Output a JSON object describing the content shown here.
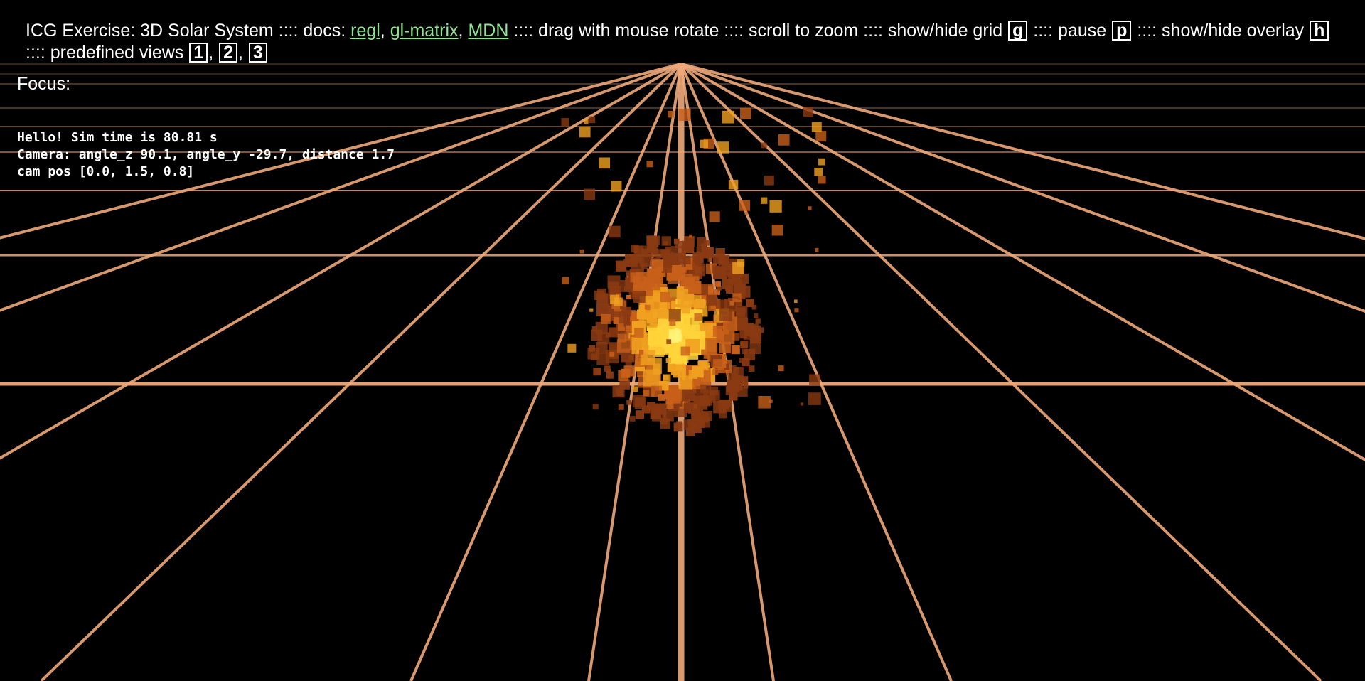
{
  "header": {
    "title": "ICG Exercise: 3D Solar System",
    "sep1": " :::: docs: ",
    "links": [
      {
        "label": "regl"
      },
      {
        "label": "gl-matrix"
      },
      {
        "label": "MDN"
      }
    ],
    "hint_rotate": " :::: drag with mouse rotate :::: scroll to zoom :::: show/hide grid ",
    "key_grid": "g",
    "hint_pause": " :::: pause ",
    "key_pause": "p",
    "hint_overlay": " :::: show/hide overlay ",
    "key_overlay": "h",
    "hint_views": " :::: predefined views ",
    "view_keys": [
      "1",
      "2",
      "3"
    ]
  },
  "focus": {
    "label": "Focus:"
  },
  "overlay": {
    "line1": "Hello! Sim time is 80.81 s",
    "line2": "Camera: angle_z 90.1, angle_y -29.7, distance 1.7",
    "line3": "cam pos [0.0, 1.5, 0.8]"
  },
  "scene": {
    "background_color": "#000000",
    "grid_color": "#f0a97a",
    "sun_colors": [
      "#fff27a",
      "#ffd43a",
      "#f0a020",
      "#c8601a",
      "#8a3a12"
    ]
  }
}
